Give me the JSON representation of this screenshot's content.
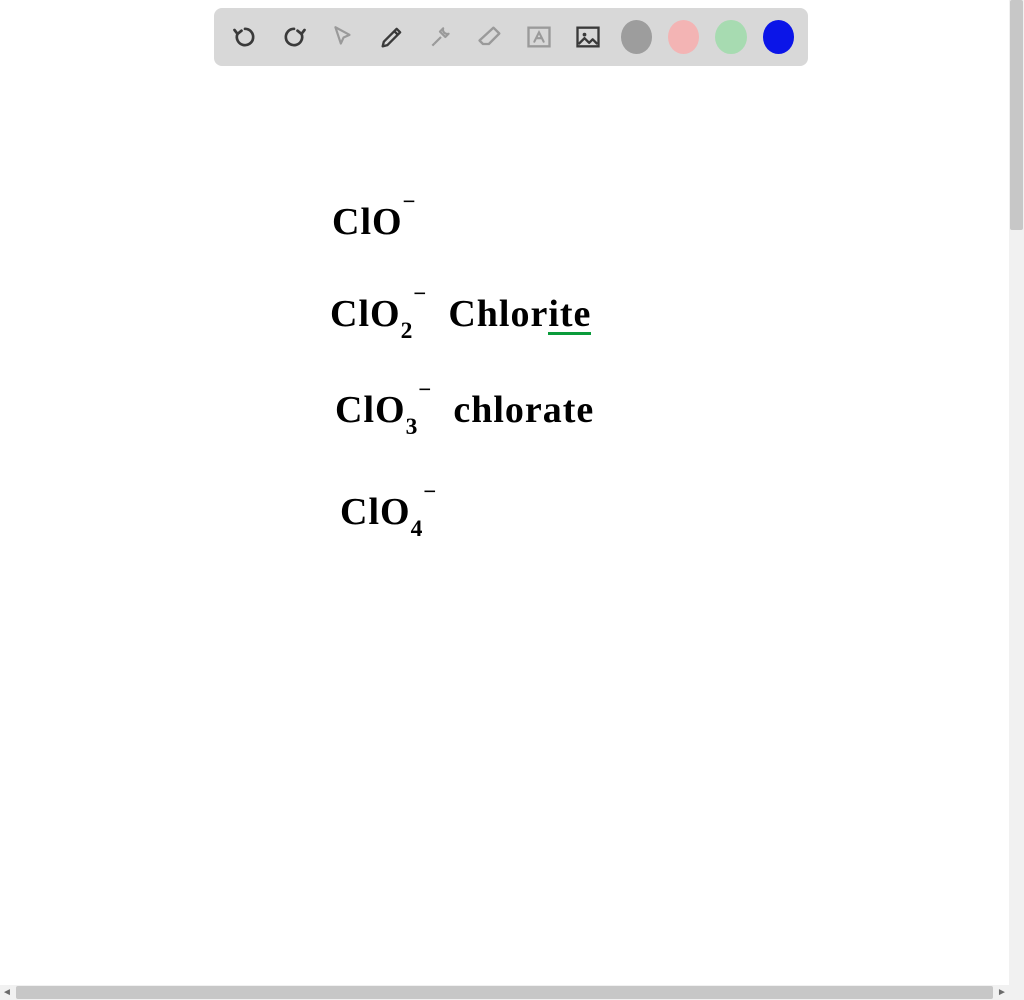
{
  "toolbar": {
    "tools": [
      {
        "name": "undo-icon"
      },
      {
        "name": "redo-icon"
      },
      {
        "name": "cursor-icon"
      },
      {
        "name": "pencil-icon"
      },
      {
        "name": "tools-icon"
      },
      {
        "name": "eraser-icon"
      },
      {
        "name": "text-box-icon"
      },
      {
        "name": "image-icon"
      }
    ],
    "colors": [
      {
        "name": "color-gray",
        "hex": "#9d9d9d"
      },
      {
        "name": "color-pink",
        "hex": "#f3b4b4"
      },
      {
        "name": "color-green",
        "hex": "#a7dbb1"
      },
      {
        "name": "color-blue",
        "hex": "#0b15e8"
      }
    ],
    "selected_color": "color-blue"
  },
  "notes": {
    "line1": {
      "formula_pre": "ClO",
      "formula_sub": "",
      "formula_sup": "−",
      "label": ""
    },
    "line2": {
      "formula_pre": "ClO",
      "formula_sub": "2",
      "formula_sup": "−",
      "label_pre": "Chlor",
      "label_ul": "ite"
    },
    "line3": {
      "formula_pre": "ClO",
      "formula_sub": "3",
      "formula_sup": "−",
      "label": "chlorate"
    },
    "line4": {
      "formula_pre": "ClO",
      "formula_sub": "4",
      "formula_sup": "−",
      "label": ""
    }
  }
}
